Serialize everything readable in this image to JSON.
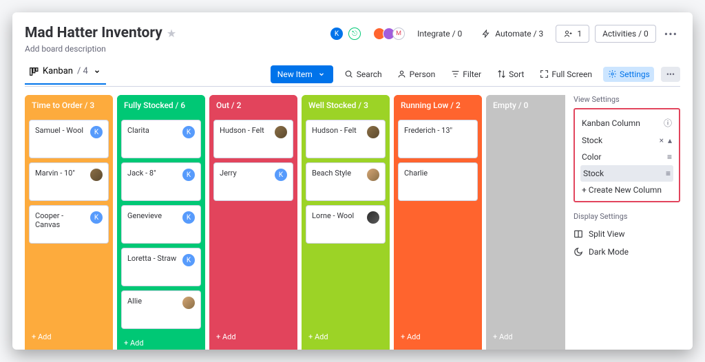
{
  "header": {
    "title": "Mad Hatter Inventory",
    "description": "Add board description",
    "integrate": "Integrate / 0",
    "automate": "Automate / 3",
    "members": "1",
    "activities": "Activities / 0"
  },
  "viewbar": {
    "view_name": "Kanban",
    "view_count": "/ 4",
    "new_item": "New Item",
    "search": "Search",
    "person": "Person",
    "filter": "Filter",
    "sort": "Sort",
    "fullscreen": "Full Screen",
    "settings": "Settings"
  },
  "lanes": [
    {
      "cls": "time",
      "title": "Time to Order / 3",
      "cards": [
        {
          "label": "Samuel - Wool",
          "av": "av-blue",
          "init": "K"
        },
        {
          "label": "Marvin - 10\"",
          "av": "av-img1",
          "init": ""
        },
        {
          "label": "Cooper - Canvas",
          "av": "av-blue",
          "init": "K"
        }
      ],
      "add": "+ Add"
    },
    {
      "cls": "fully",
      "title": "Fully Stocked / 6",
      "cards": [
        {
          "label": "Clarita",
          "av": "av-blue",
          "init": "K"
        },
        {
          "label": "Jack - 8\"",
          "av": "av-blue",
          "init": "K"
        },
        {
          "label": "Genevieve",
          "av": "av-blue",
          "init": "K"
        },
        {
          "label": "Loretta - Straw",
          "av": "av-blue",
          "init": "K"
        },
        {
          "label": "Allie",
          "av": "av-img2",
          "init": ""
        }
      ],
      "add": "+ Add"
    },
    {
      "cls": "out",
      "title": "Out / 2",
      "cards": [
        {
          "label": "Hudson - Felt",
          "av": "av-img1",
          "init": ""
        },
        {
          "label": "Jerry",
          "av": "av-blue",
          "init": "K"
        }
      ],
      "add": "+ Add"
    },
    {
      "cls": "well",
      "title": "Well Stocked / 3",
      "cards": [
        {
          "label": "Hudson - Felt",
          "av": "av-img1",
          "init": ""
        },
        {
          "label": "Beach Style",
          "av": "av-img2",
          "init": ""
        },
        {
          "label": "Lorne - Wool",
          "av": "av-img3",
          "init": ""
        }
      ],
      "add": "+ Add"
    },
    {
      "cls": "low",
      "title": "Running Low / 2",
      "cards": [
        {
          "label": "Frederich - 13\"",
          "av": "",
          "init": ""
        },
        {
          "label": "Charlie",
          "av": "",
          "init": ""
        }
      ],
      "add": "+ Add"
    },
    {
      "cls": "empty",
      "title": "Empty / 0",
      "cards": [],
      "add": "+ Add"
    }
  ],
  "settings": {
    "view_settings": "View Settings",
    "kanban_column": "Kanban Column",
    "selected": "Stock",
    "opt_color": "Color",
    "opt_stock": "Stock",
    "create_new": "+ Create New Column",
    "display_settings": "Display Settings",
    "split_view": "Split View",
    "dark_mode": "Dark Mode"
  }
}
